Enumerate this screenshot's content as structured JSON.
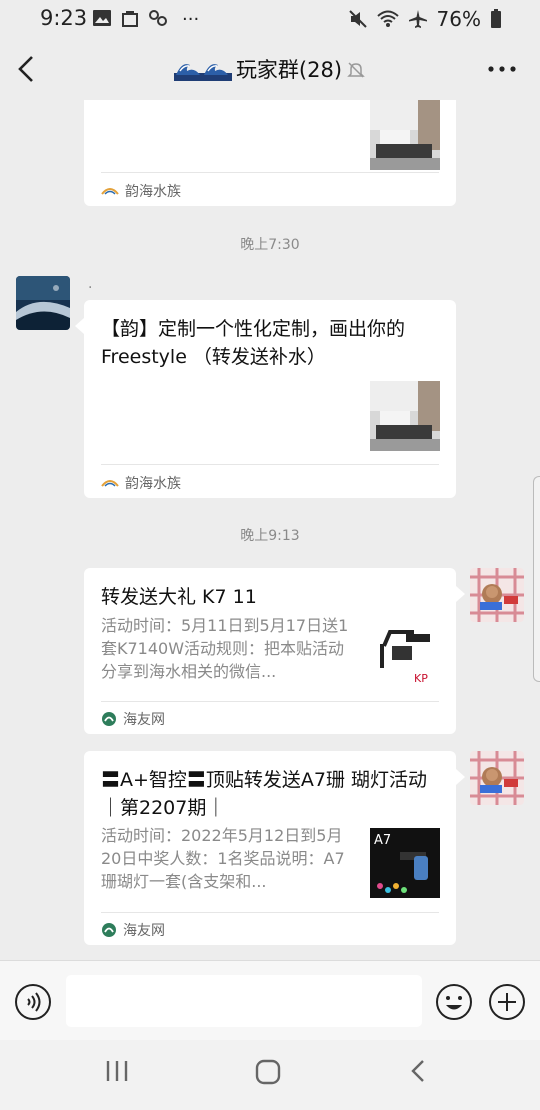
{
  "status": {
    "time": "9:23",
    "dots": "···",
    "battery": "76%"
  },
  "header": {
    "title": "玩家群(28)"
  },
  "messages": {
    "card1": {
      "source": "韵海水族"
    },
    "ts1": "晚上7:30",
    "sender_name": ".",
    "card2": {
      "title": "【韵】定制一个性化定制，画出你的Freestyle （转发送补水）",
      "source": "韵海水族"
    },
    "ts2": "晚上9:13",
    "card3": {
      "title": "转发送大礼 K7 11",
      "desc": "活动时间：5月11日到5月17日送1套K7140W活动规则：把本贴活动分享到海水相关的微信...",
      "source": "海友网"
    },
    "card4": {
      "title": "〓A+智控〓顶贴转发送A7珊 瑚灯活动｜第2207期｜",
      "desc": "活动时间：2022年5月12日到5月20日中奖人数：1名奖品说明：A7珊瑚灯一套(含支架和...",
      "source": "海友网",
      "thumb_label": "A7"
    }
  },
  "colors": {
    "bg": "#ededed",
    "card": "#ffffff",
    "muted": "#8a8a8a"
  }
}
